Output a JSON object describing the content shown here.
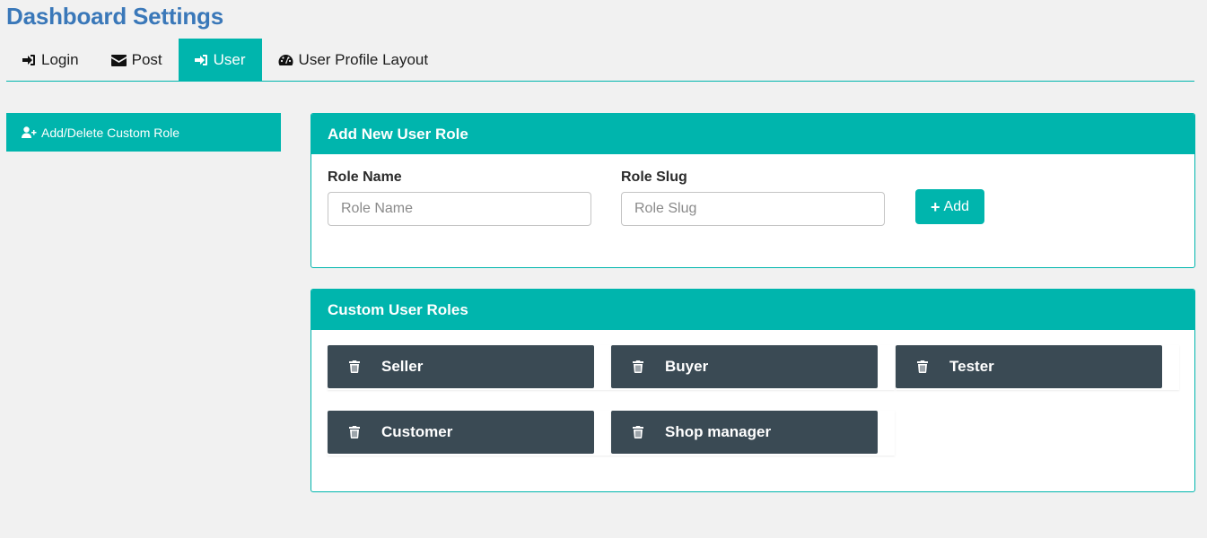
{
  "header": {
    "title": "Dashboard Settings"
  },
  "tabs": [
    {
      "label": "Login",
      "icon": "sign-in-icon"
    },
    {
      "label": "Post",
      "icon": "envelope-icon"
    },
    {
      "label": "User",
      "icon": "sign-in-icon",
      "active": true
    },
    {
      "label": "User Profile Layout",
      "icon": "dashboard-icon"
    }
  ],
  "sidebar": {
    "items": [
      {
        "label": "Add/Delete Custom Role",
        "icon": "user-plus-icon"
      }
    ]
  },
  "add_role": {
    "title": "Add New User Role",
    "role_name": {
      "label": "Role Name",
      "placeholder": "Role Name",
      "value": ""
    },
    "role_slug": {
      "label": "Role Slug",
      "placeholder": "Role Slug",
      "value": ""
    },
    "add_button": "Add"
  },
  "custom_roles": {
    "title": "Custom User Roles",
    "roles": [
      "Seller",
      "Buyer",
      "Tester",
      "Customer",
      "Shop manager"
    ]
  },
  "colors": {
    "accent": "#00b5ad",
    "title": "#3a78b9",
    "chip": "#3a4a54",
    "background": "#f1f1f1"
  }
}
